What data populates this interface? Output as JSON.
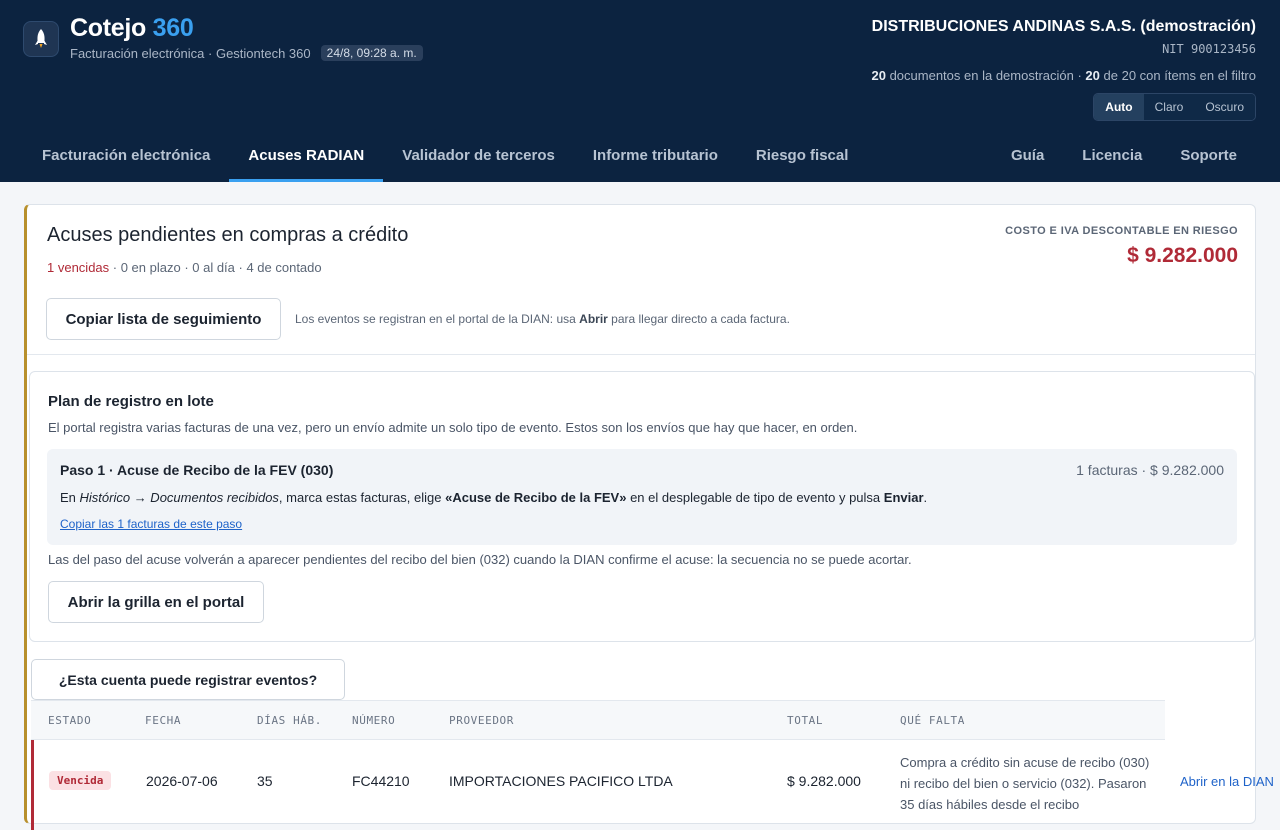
{
  "app": {
    "name": "Cotejo",
    "name_accent": "360",
    "subtitle": "Facturación electrónica · Gestiontech 360",
    "timestamp": "24/8, 09:28 a. m."
  },
  "company": {
    "name": "DISTRIBUCIONES ANDINAS S.A.S. (demostración)",
    "nit": "NIT 900123456",
    "docs_total": "20",
    "docs_total_label": "documentos en la demostración ·",
    "docs_filtered": "20",
    "docs_filtered_label": "de 20 con ítems en el filtro"
  },
  "theme": {
    "options": [
      "Auto",
      "Claro",
      "Oscuro"
    ],
    "selected": "Auto"
  },
  "nav": {
    "tabs": [
      "Facturación electrónica",
      "Acuses RADIAN",
      "Validador de terceros",
      "Informe tributario",
      "Riesgo fiscal"
    ],
    "right": [
      "Guía",
      "Licencia",
      "Soporte"
    ],
    "active": "Acuses RADIAN"
  },
  "card": {
    "title": "Acuses pendientes en compras a crédito",
    "counts_overdue": "1 vencidas",
    "counts_rest": " · 0 en plazo · 0 al día · 4 de contado",
    "risk_label": "COSTO E IVA DESCONTABLE EN RIESGO",
    "risk_value": "$ 9.282.000",
    "copy_button": "Copiar lista de seguimiento",
    "hint_pre": "Los eventos se registran en el portal de la DIAN: usa ",
    "hint_bold": "Abrir",
    "hint_post": " para llegar directo a cada factura."
  },
  "plan": {
    "title": "Plan de registro en lote",
    "description": "El portal registra varias facturas de una vez, pero un envío admite un solo tipo de evento. Estos son los envíos que hay que hacer, en orden.",
    "step": {
      "title": "Paso 1 · Acuse de Recibo de la FEV (030)",
      "meta": "1 facturas · $ 9.282.000",
      "instr_1": "En ",
      "instr_path": "Histórico → Documentos recibidos",
      "instr_2": ", marca estas facturas, elige ",
      "instr_event": "«Acuse de Recibo de la FEV»",
      "instr_3": " en el desplegable de tipo de evento y pulsa ",
      "instr_send": "Enviar",
      "instr_4": ".",
      "link": "Copiar las 1 facturas de este paso"
    },
    "note": "Las del paso del acuse volverán a aparecer pendientes del recibo del bien (032) cuando la DIAN confirme el acuse: la secuencia no se puede acortar.",
    "grid_button": "Abrir la grilla en el portal"
  },
  "permissions_button": "¿Esta cuenta puede registrar eventos?",
  "table": {
    "headers": [
      "ESTADO",
      "FECHA",
      "DÍAS HÁB.",
      "NÚMERO",
      "PROVEEDOR",
      "TOTAL",
      "QUÉ FALTA"
    ],
    "rows": [
      {
        "status": "Vencida",
        "date": "2026-07-06",
        "days": "35",
        "number": "FC44210",
        "provider": "IMPORTACIONES PACIFICO LTDA",
        "total": "$ 9.282.000",
        "missing": "Compra a crédito sin acuse de recibo (030) ni recibo del bien o servicio (032). Pasaron 35 días hábiles desde el recibo",
        "action": "Abrir en la DIAN"
      }
    ]
  },
  "colors": {
    "header": "#0c2340",
    "accent": "#3aa0f0",
    "danger": "#b02a37",
    "card_stripe": "#b8902c"
  }
}
